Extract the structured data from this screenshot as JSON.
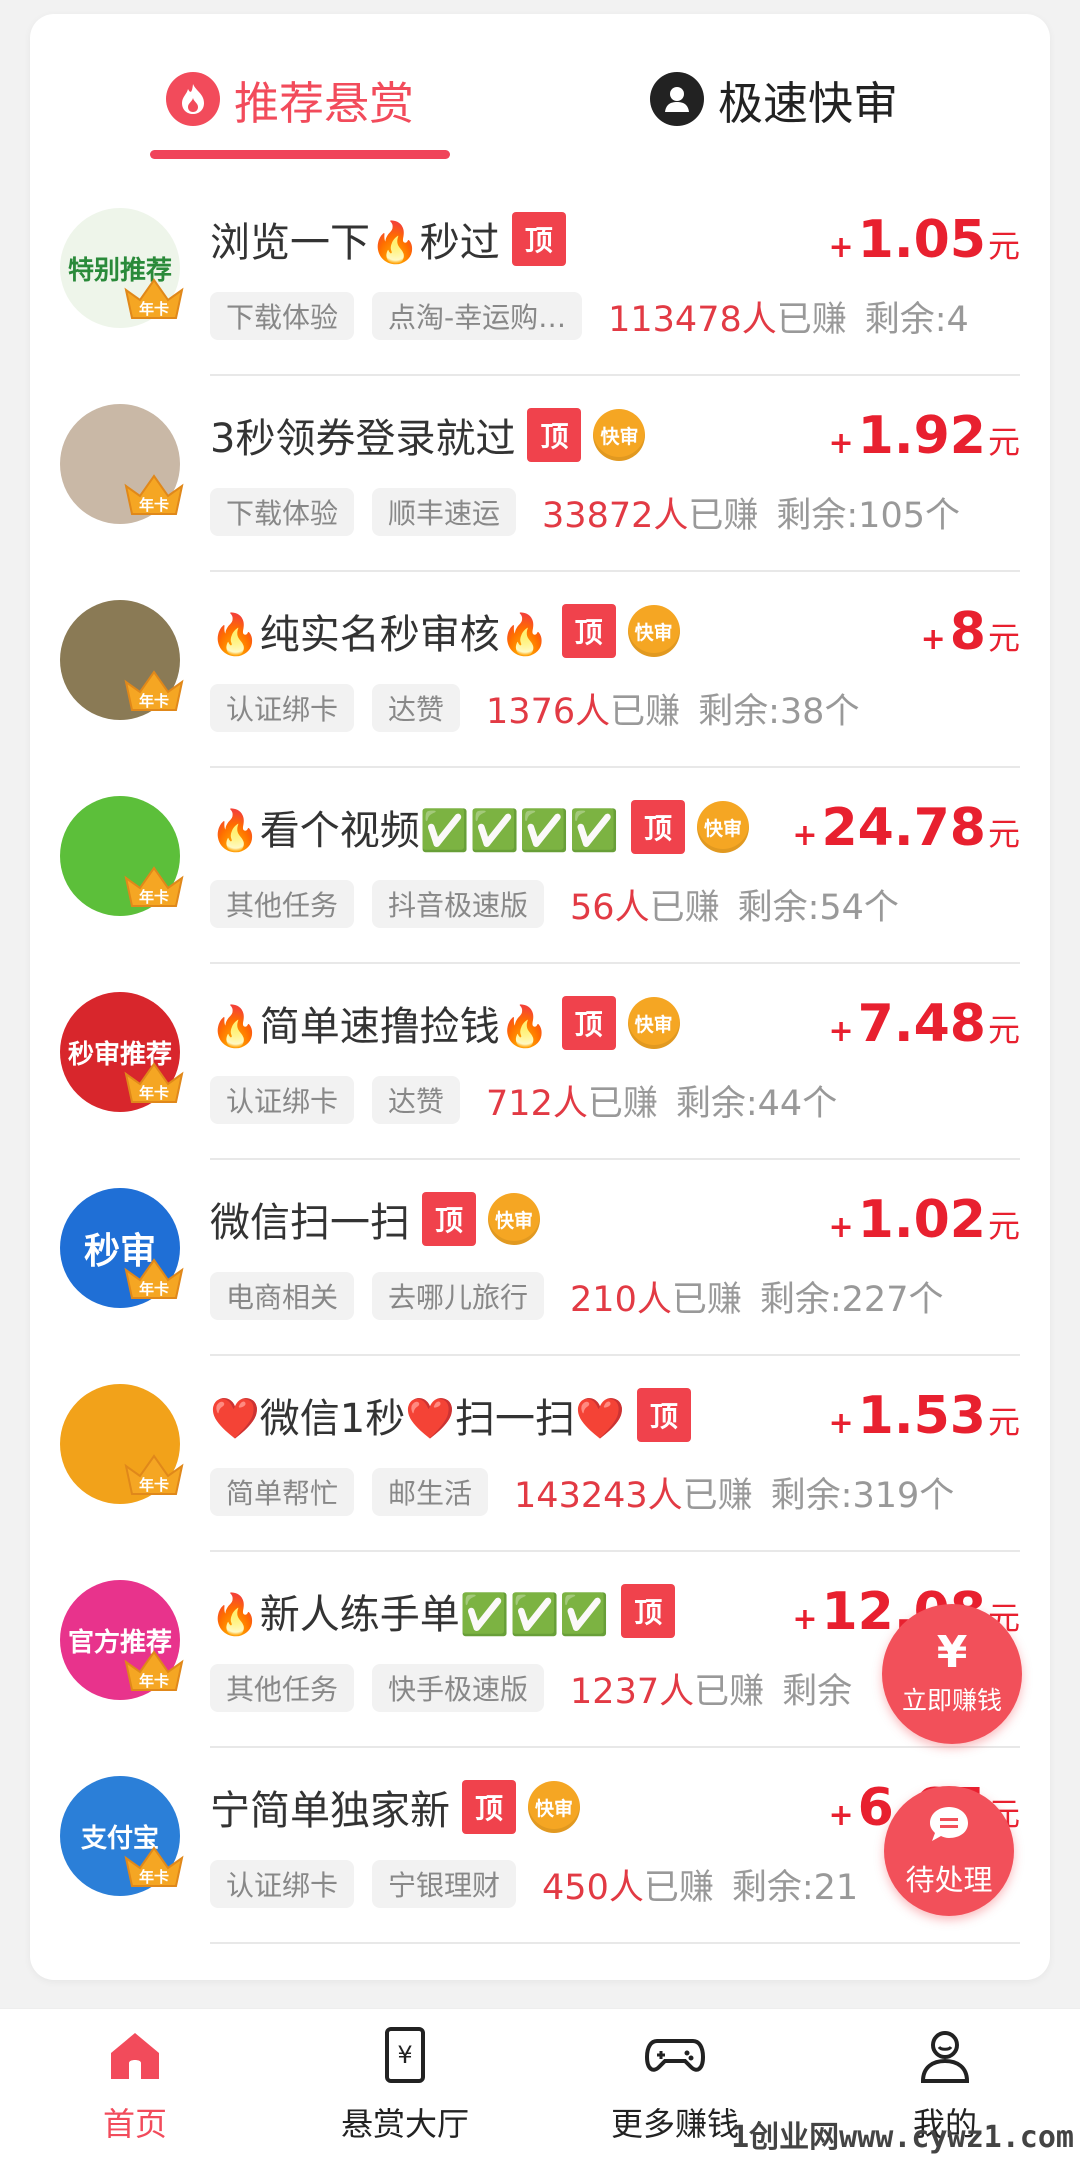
{
  "tabs": [
    {
      "label": "推荐悬赏",
      "active": true,
      "icon": "fire-icon"
    },
    {
      "label": "极速快审",
      "active": false,
      "icon": "user-icon"
    }
  ],
  "tasks": [
    {
      "title": "浏览一下🔥秒过",
      "top": "顶",
      "fast": "",
      "price": "1.05",
      "plus": "+",
      "unit": "元",
      "tags": [
        "下载体验",
        "点淘-幸运购…"
      ],
      "earned_count": "113478人",
      "earned_label": "已赚",
      "remain": "剩余:4",
      "avatar_text": "特别推荐",
      "avatar_bg": "#eef5ea",
      "avatar_fg": "#2a8a3a",
      "crown": "年卡"
    },
    {
      "title": "3秒领券登录就过",
      "top": "顶",
      "fast": "快审",
      "price": "1.92",
      "plus": "+",
      "unit": "元",
      "tags": [
        "下载体验",
        "顺丰速运"
      ],
      "earned_count": "33872人",
      "earned_label": "已赚",
      "remain": "剩余:105个",
      "avatar_text": "",
      "avatar_bg": "#c9b8a6",
      "avatar_fg": "#fff",
      "crown": "年卡"
    },
    {
      "title": "🔥纯实名秒审核🔥",
      "top": "顶",
      "fast": "快审",
      "price": "8",
      "plus": "+",
      "unit": "元",
      "tags": [
        "认证绑卡",
        "达赞"
      ],
      "earned_count": "1376人",
      "earned_label": "已赚",
      "remain": "剩余:38个",
      "avatar_text": "",
      "avatar_bg": "#8a7a55",
      "avatar_fg": "#fff",
      "crown": "年卡"
    },
    {
      "title": "🔥看个视频✅✅✅✅",
      "top": "顶",
      "fast": "快审",
      "price": "24.78",
      "plus": "+",
      "unit": "元",
      "tags": [
        "其他任务",
        "抖音极速版"
      ],
      "earned_count": "56人",
      "earned_label": "已赚",
      "remain": "剩余:54个",
      "avatar_text": "",
      "avatar_bg": "#5cbf3a",
      "avatar_fg": "#fff",
      "crown": "年卡"
    },
    {
      "title": "🔥简单速撸捡钱🔥",
      "top": "顶",
      "fast": "快审",
      "price": "7.48",
      "plus": "+",
      "unit": "元",
      "tags": [
        "认证绑卡",
        "达赞"
      ],
      "earned_count": "712人",
      "earned_label": "已赚",
      "remain": "剩余:44个",
      "avatar_text": "秒审推荐",
      "avatar_bg": "#d8262c",
      "avatar_fg": "#fff",
      "crown": "年卡"
    },
    {
      "title": "微信扫一扫",
      "top": "顶",
      "fast": "快审",
      "price": "1.02",
      "plus": "+",
      "unit": "元",
      "tags": [
        "电商相关",
        "去哪儿旅行"
      ],
      "earned_count": "210人",
      "earned_label": "已赚",
      "remain": "剩余:227个",
      "avatar_text": "秒审",
      "avatar_bg": "#1f6fd6",
      "avatar_fg": "#fff",
      "crown": "年卡"
    },
    {
      "title": "❤️微信1秒❤️扫一扫❤️",
      "top": "顶",
      "fast": "",
      "price": "1.53",
      "plus": "+",
      "unit": "元",
      "tags": [
        "简单帮忙",
        "邮生活"
      ],
      "earned_count": "143243人",
      "earned_label": "已赚",
      "remain": "剩余:319个",
      "avatar_text": "",
      "avatar_bg": "#f2a21a",
      "avatar_fg": "#fff",
      "crown": "年卡"
    },
    {
      "title": "🔥新人练手单✅✅✅",
      "top": "顶",
      "fast": "",
      "price": "12.08",
      "plus": "+",
      "unit": "元",
      "tags": [
        "其他任务",
        "快手极速版"
      ],
      "earned_count": "1237人",
      "earned_label": "已赚",
      "remain": "剩余",
      "avatar_text": "官方推荐",
      "avatar_bg": "#e8338c",
      "avatar_fg": "#fff",
      "crown": "年卡"
    },
    {
      "title": "宁简单独家新",
      "top": "顶",
      "fast": "快审",
      "price": "6.65",
      "plus": "+",
      "unit": "元",
      "tags": [
        "认证绑卡",
        "宁银理财"
      ],
      "earned_count": "450人",
      "earned_label": "已赚",
      "remain": "剩余:21",
      "avatar_text": "支付宝",
      "avatar_bg": "#2b7fd8",
      "avatar_fg": "#fff",
      "crown": "年卡"
    }
  ],
  "float_buttons": {
    "earn_icon": "¥",
    "earn_label": "立即赚钱",
    "pending_label": "待处理"
  },
  "nav": [
    {
      "label": "首页",
      "icon": "home-icon",
      "active": true
    },
    {
      "label": "悬赏大厅",
      "icon": "reward-hall-icon",
      "active": false
    },
    {
      "label": "更多赚钱",
      "icon": "gamepad-icon",
      "active": false
    },
    {
      "label": "我的",
      "icon": "profile-icon",
      "active": false
    }
  ],
  "watermark": "1创业网www.cywz1.com",
  "colors": {
    "accent": "#f24b5b",
    "price": "#e8202f",
    "fast_badge": "#f5a623"
  }
}
